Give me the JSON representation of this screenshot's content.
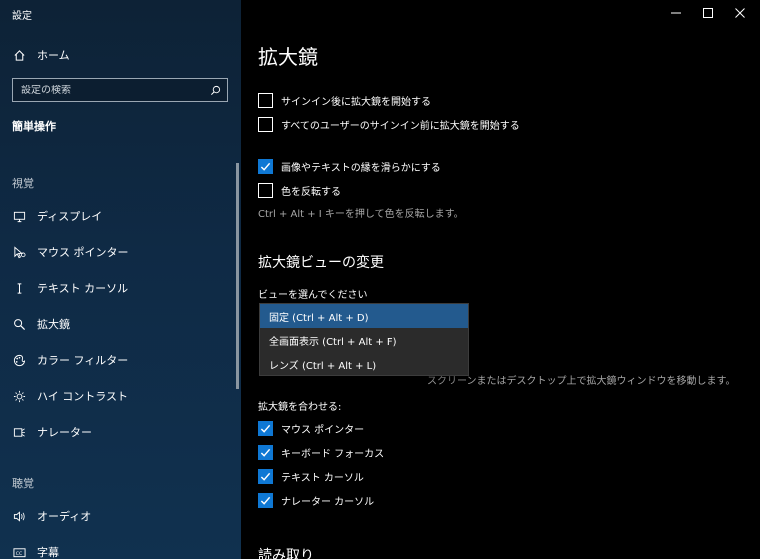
{
  "window": {
    "title": "設定"
  },
  "sidebar": {
    "home_label": "ホーム",
    "search_placeholder": "設定の検索",
    "category_title": "簡単操作",
    "groups": [
      {
        "label": "視覚"
      },
      {
        "label": "聴覚"
      }
    ],
    "items": [
      {
        "label": "ディスプレイ",
        "icon": "monitor-icon"
      },
      {
        "label": "マウス ポインター",
        "icon": "mouse-pointer-icon"
      },
      {
        "label": "テキスト カーソル",
        "icon": "text-cursor-icon"
      },
      {
        "label": "拡大鏡",
        "icon": "magnifier-icon"
      },
      {
        "label": "カラー フィルター",
        "icon": "color-filter-icon"
      },
      {
        "label": "ハイ コントラスト",
        "icon": "high-contrast-icon"
      },
      {
        "label": "ナレーター",
        "icon": "narrator-icon"
      },
      {
        "label": "オーディオ",
        "icon": "speaker-icon"
      },
      {
        "label": "字幕",
        "icon": "captions-icon"
      }
    ]
  },
  "main": {
    "title": "拡大鏡",
    "options": [
      {
        "label": "サインイン後に拡大鏡を開始する",
        "checked": false
      },
      {
        "label": "すべてのユーザーのサインイン前に拡大鏡を開始する",
        "checked": false
      },
      {
        "label": "画像やテキストの縁を滑らかにする",
        "checked": true
      },
      {
        "label": "色を反転する",
        "checked": false
      }
    ],
    "invert_hint": "Ctrl + Alt + I キーを押して色を反転します。",
    "view_section_title": "拡大鏡ビューの変更",
    "view_select_label": "ビューを選んでください",
    "view_options": [
      {
        "label": "固定 (Ctrl + Alt + D)",
        "selected": true
      },
      {
        "label": "全画面表示 (Ctrl + Alt + F)",
        "selected": false
      },
      {
        "label": "レンズ (Ctrl + Alt + L)",
        "selected": false
      }
    ],
    "partial_hint_visible": "スクリーンまたはデスクトップ上で拡大鏡ウィンドウを移動します。",
    "follow_label": "拡大鏡を合わせる:",
    "follow_options": [
      {
        "label": "マウス ポインター",
        "checked": true
      },
      {
        "label": "キーボード フォーカス",
        "checked": true
      },
      {
        "label": "テキスト カーソル",
        "checked": true
      },
      {
        "label": "ナレーター カーソル",
        "checked": true
      }
    ],
    "next_section_title": "読み取り"
  },
  "colors": {
    "accent": "#0f78d4",
    "sidebar_bg": "#0f2a45",
    "selected_item": "#235a8e"
  }
}
